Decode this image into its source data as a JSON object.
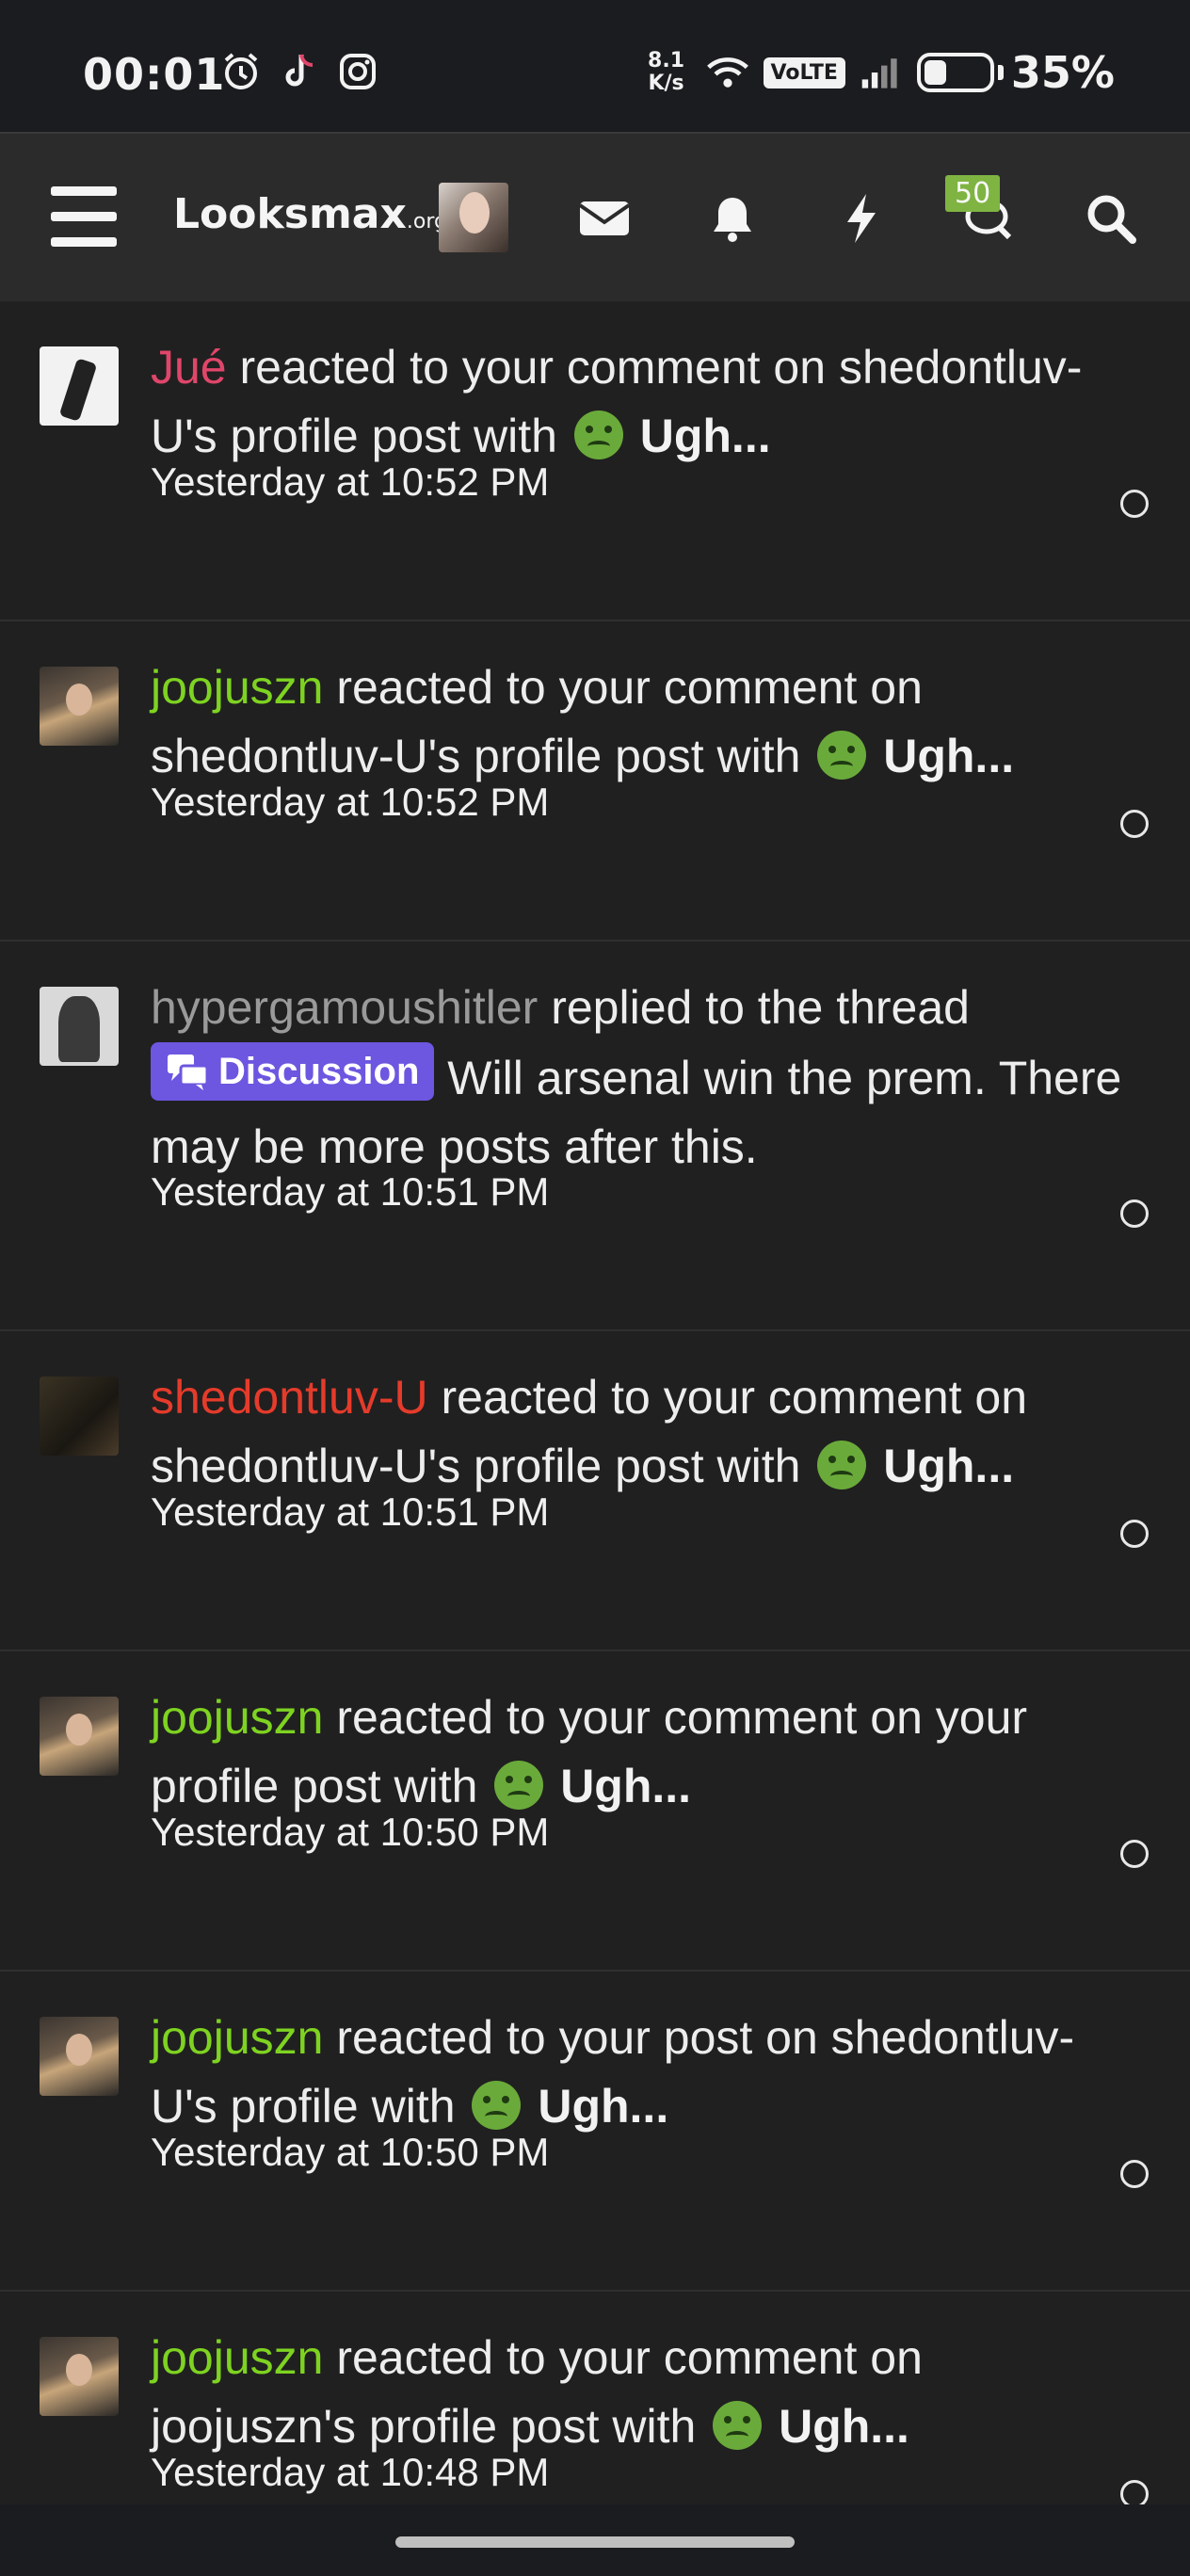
{
  "status_bar": {
    "time": "00:01",
    "network_speed_value": "8.1",
    "network_speed_unit": "K/s",
    "volte": "VoLTE",
    "battery_percent": "35%",
    "battery_level": 0.35
  },
  "nav": {
    "logo_main": "Looksmax",
    "logo_suffix": ".org",
    "alerts_badge": "50"
  },
  "notifications": [
    {
      "user": "Jué",
      "user_color": "#e0466a",
      "action": " reacted to your comment on shedontluv-U's profile post with ",
      "reaction": "Ugh...",
      "time": "Yesterday at 10:52 PM"
    },
    {
      "user": "joojuszn",
      "user_color": "#7ed321",
      "action": " reacted to your comment on shedontluv-U's profile post with ",
      "reaction": "Ugh...",
      "time": "Yesterday at 10:52 PM"
    },
    {
      "user": "hypergamoushitler",
      "user_color": "#9a9a9a",
      "action": " replied to the thread ",
      "prefix": "Discussion",
      "thread_title": " Will arsenal win the prem.",
      "extra": " There may be more posts after this.",
      "time": "Yesterday at 10:51 PM"
    },
    {
      "user": "shedontluv-U",
      "user_color": "#e53b2b",
      "action": " reacted to your comment on shedontluv-U's profile post with ",
      "reaction": "Ugh...",
      "time": "Yesterday at 10:51 PM"
    },
    {
      "user": "joojuszn",
      "user_color": "#7ed321",
      "action": " reacted to your comment on your profile post with ",
      "reaction": "Ugh...",
      "time": "Yesterday at 10:50 PM"
    },
    {
      "user": "joojuszn",
      "user_color": "#7ed321",
      "action": " reacted to your post on shedontluv-U's profile with ",
      "reaction": "Ugh...",
      "time": "Yesterday at 10:50 PM"
    },
    {
      "user": "joojuszn",
      "user_color": "#7ed321",
      "action": " reacted to your comment on joojuszn's profile post with ",
      "reaction": "Ugh...",
      "time": "Yesterday at 10:48 PM"
    }
  ]
}
